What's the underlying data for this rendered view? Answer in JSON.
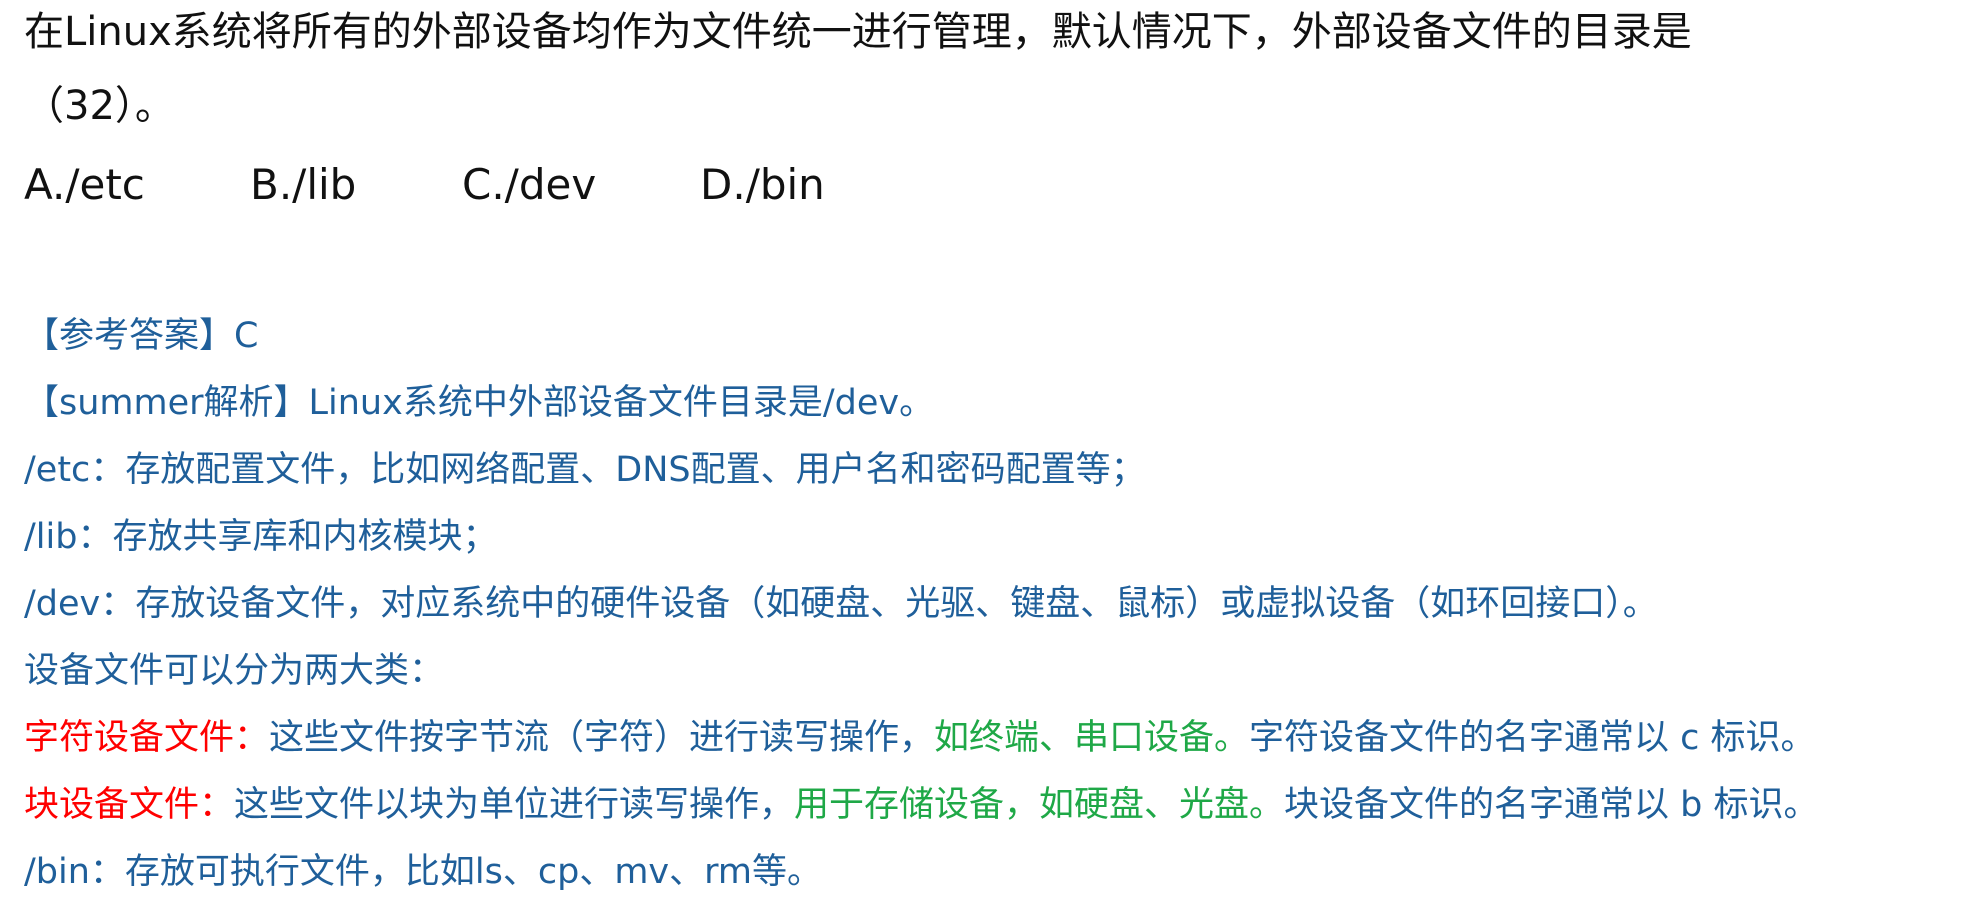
{
  "question": {
    "line1": "在Linux系统将所有的外部设备均作为文件统一进行管理，默认情况下，外部设备文件的目录是",
    "line2": "（32）。",
    "options": [
      "A./etc",
      "B./lib",
      "C./dev",
      "D./bin"
    ]
  },
  "explanation": {
    "answer": "【参考答案】C",
    "analysis": "【summer解析】Linux系统中外部设备文件目录是/dev。",
    "etc": "/etc：存放配置文件，比如网络配置、DNS配置、用户名和密码配置等；",
    "lib": "/lib：存放共享库和内核模块；",
    "dev": "/dev：存放设备文件，对应系统中的硬件设备（如硬盘、光驱、键盘、鼠标）或虚拟设备（如环回接口）。",
    "categories": "设备文件可以分为两大类：",
    "char_device": {
      "label": "字符设备文件：",
      "text_a": "这些文件按字节流（字符）进行读写操作，",
      "examples": "如终端、串口设备。",
      "text_b": "字符设备文件的名字通常以 c 标识。"
    },
    "block_device": {
      "label": "块设备文件：",
      "text_a": "这些文件以块为单位进行读写操作，",
      "examples": "用于存储设备，如硬盘、光盘。",
      "text_b": "块设备文件的名字通常以 b 标识。"
    },
    "bin": "/bin：存放可执行文件，比如ls、cp、mv、rm等。"
  },
  "colors": {
    "question_text": "#111111",
    "explanation_text": "#1f5f9a",
    "highlight_red": "#ff0000",
    "highlight_green": "#1fa847"
  }
}
